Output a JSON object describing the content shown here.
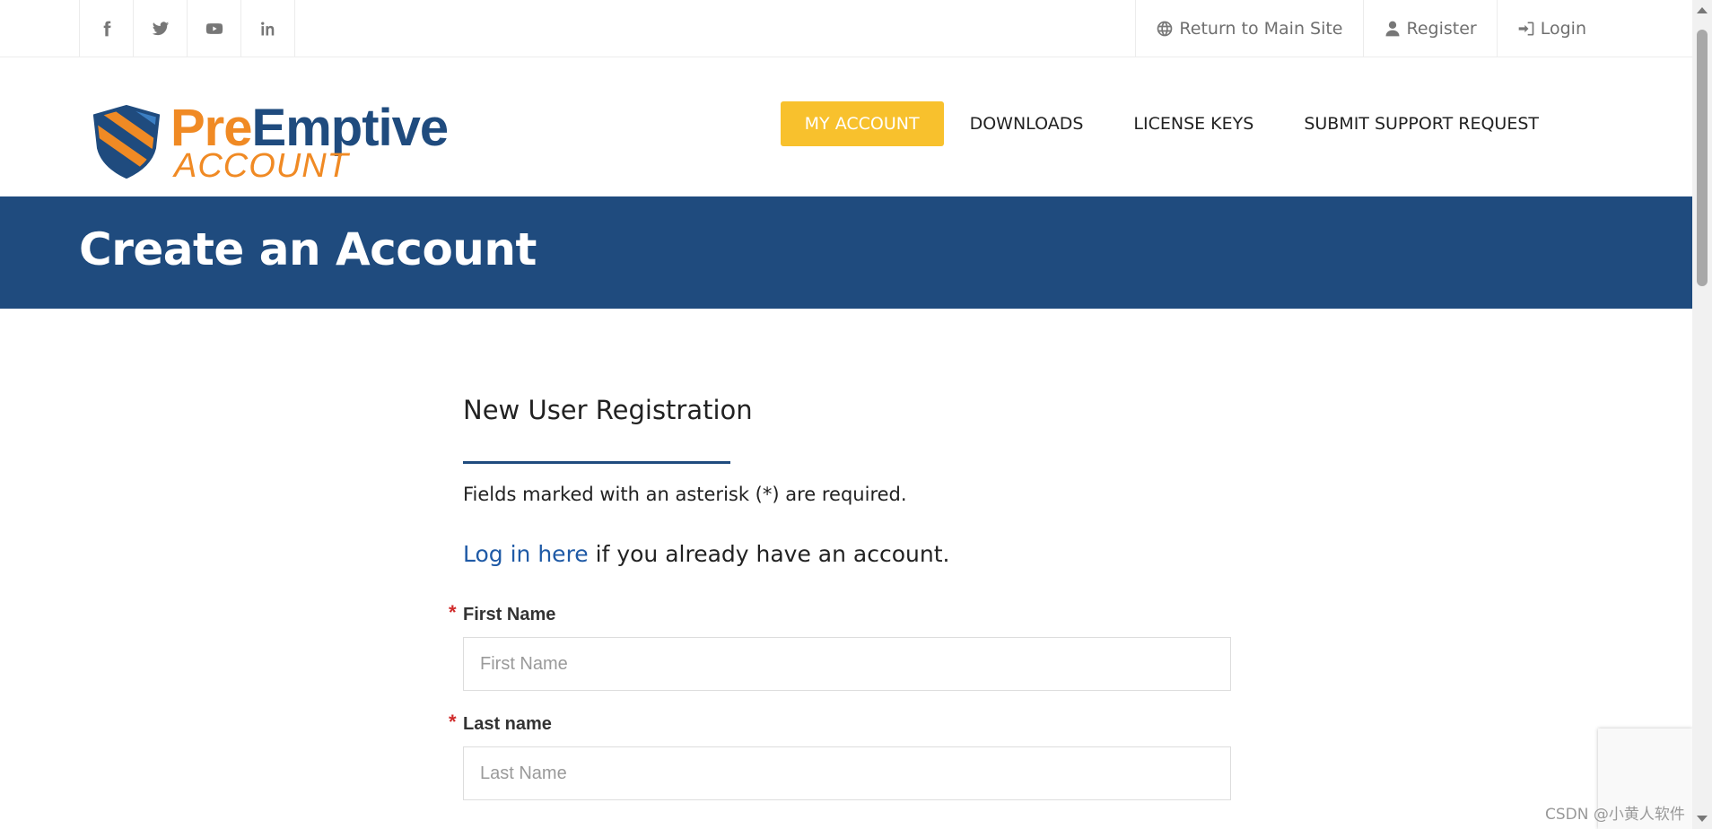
{
  "topbar": {
    "social_icons": [
      "facebook-icon",
      "twitter-icon",
      "youtube-icon",
      "linkedin-icon"
    ],
    "links": [
      {
        "icon": "globe-icon",
        "label": "Return to Main Site"
      },
      {
        "icon": "user-icon",
        "label": "Register"
      },
      {
        "icon": "sign-in-icon",
        "label": "Login"
      }
    ]
  },
  "logo": {
    "word1": "Pre",
    "word2": "Emptive",
    "sub": "ACCOUNT"
  },
  "nav": {
    "items": [
      {
        "label": "MY ACCOUNT",
        "active": true
      },
      {
        "label": "DOWNLOADS"
      },
      {
        "label": "LICENSE KEYS"
      },
      {
        "label": "SUBMIT SUPPORT REQUEST"
      }
    ]
  },
  "banner": {
    "title": "Create an Account"
  },
  "form": {
    "heading": "New User Registration",
    "note": "Fields marked with an asterisk (*) are required.",
    "login_link": "Log in here",
    "login_suffix": " if you already have an account.",
    "fields": [
      {
        "label": "First Name",
        "required": true,
        "placeholder": "First Name",
        "value": ""
      },
      {
        "label": "Last name",
        "required": true,
        "placeholder": "Last Name",
        "value": ""
      }
    ]
  },
  "watermark": "CSDN @小黄人软件",
  "colors": {
    "brand_blue": "#1f4b7e",
    "brand_orange": "#f08a24",
    "nav_active": "#f8c12d",
    "link": "#1f5aa6",
    "required": "#d02b2b"
  }
}
